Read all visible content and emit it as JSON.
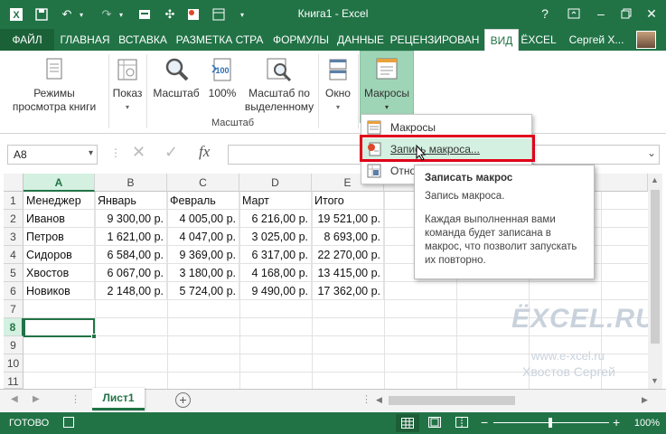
{
  "window": {
    "title": "Книга1 - Excel",
    "help": "?",
    "accent": "#217346"
  },
  "quick_access": {
    "app_icon": "excel-icon",
    "save_icon": "save-icon",
    "undo_icon": "undo-icon",
    "redo_icon": "redo-icon"
  },
  "tabs": [
    {
      "label": "ФАЙЛ"
    },
    {
      "label": "ГЛАВНАЯ"
    },
    {
      "label": "ВСТАВКА"
    },
    {
      "label": "РАЗМЕТКА СТРА"
    },
    {
      "label": "ФОРМУЛЫ"
    },
    {
      "label": "ДАННЫЕ"
    },
    {
      "label": "РЕЦЕНЗИРОВАН"
    },
    {
      "label": "ВИД"
    },
    {
      "label": "ЁXCEL"
    }
  ],
  "user": "Сергей Х...",
  "ribbon": {
    "view_modes": "Режимы просмотра книги",
    "show": "Показ",
    "zoom": "Масштаб",
    "zoom100": "100%",
    "zoom_sel": "Масштаб по выделенному",
    "window": "Окно",
    "macros": "Макросы",
    "group_zoom": "Масштаб"
  },
  "formula_bar": {
    "name_box": "A8",
    "fx": "fx",
    "cancel": "✕",
    "enter": "✓"
  },
  "columns": [
    "A",
    "B",
    "C",
    "D",
    "E"
  ],
  "rows": [
    "1",
    "2",
    "3",
    "4",
    "5",
    "6",
    "7",
    "8",
    "9",
    "10",
    "11"
  ],
  "table": {
    "header": [
      "Менеджер",
      "Январь",
      "Февраль",
      "Март",
      "Итого"
    ],
    "data": [
      [
        "Иванов",
        "9 300,00 р.",
        "4 005,00 р.",
        "6 216,00 р.",
        "19 521,00 р."
      ],
      [
        "Петров",
        "1 621,00 р.",
        "4 047,00 р.",
        "3 025,00 р.",
        "8 693,00 р."
      ],
      [
        "Сидоров",
        "6 584,00 р.",
        "9 369,00 р.",
        "6 317,00 р.",
        "22 270,00 р."
      ],
      [
        "Хвостов",
        "6 067,00 р.",
        "3 180,00 р.",
        "4 168,00 р.",
        "13 415,00 р."
      ],
      [
        "Новиков",
        "2 148,00 р.",
        "5 724,00 р.",
        "9 490,00 р.",
        "17 362,00 р."
      ]
    ]
  },
  "dropdown": {
    "items": [
      "Макросы",
      "Запись макроса...",
      "Отно"
    ]
  },
  "tooltip": {
    "title": "Записать макрос",
    "subtitle": "Запись макроса.",
    "body": "Каждая выполненная вами команда будет записана в макрос, что позволит запускать их повторно."
  },
  "sheet": {
    "name": "Лист1",
    "add": "+"
  },
  "status": {
    "ready": "ГОТОВО",
    "zoom": "100%",
    "minus": "−",
    "plus": "+"
  },
  "watermark": {
    "brand": "ЁXCEL.RU",
    "url": "www.e-xcel.ru",
    "author": "Хвостов Сергей"
  }
}
